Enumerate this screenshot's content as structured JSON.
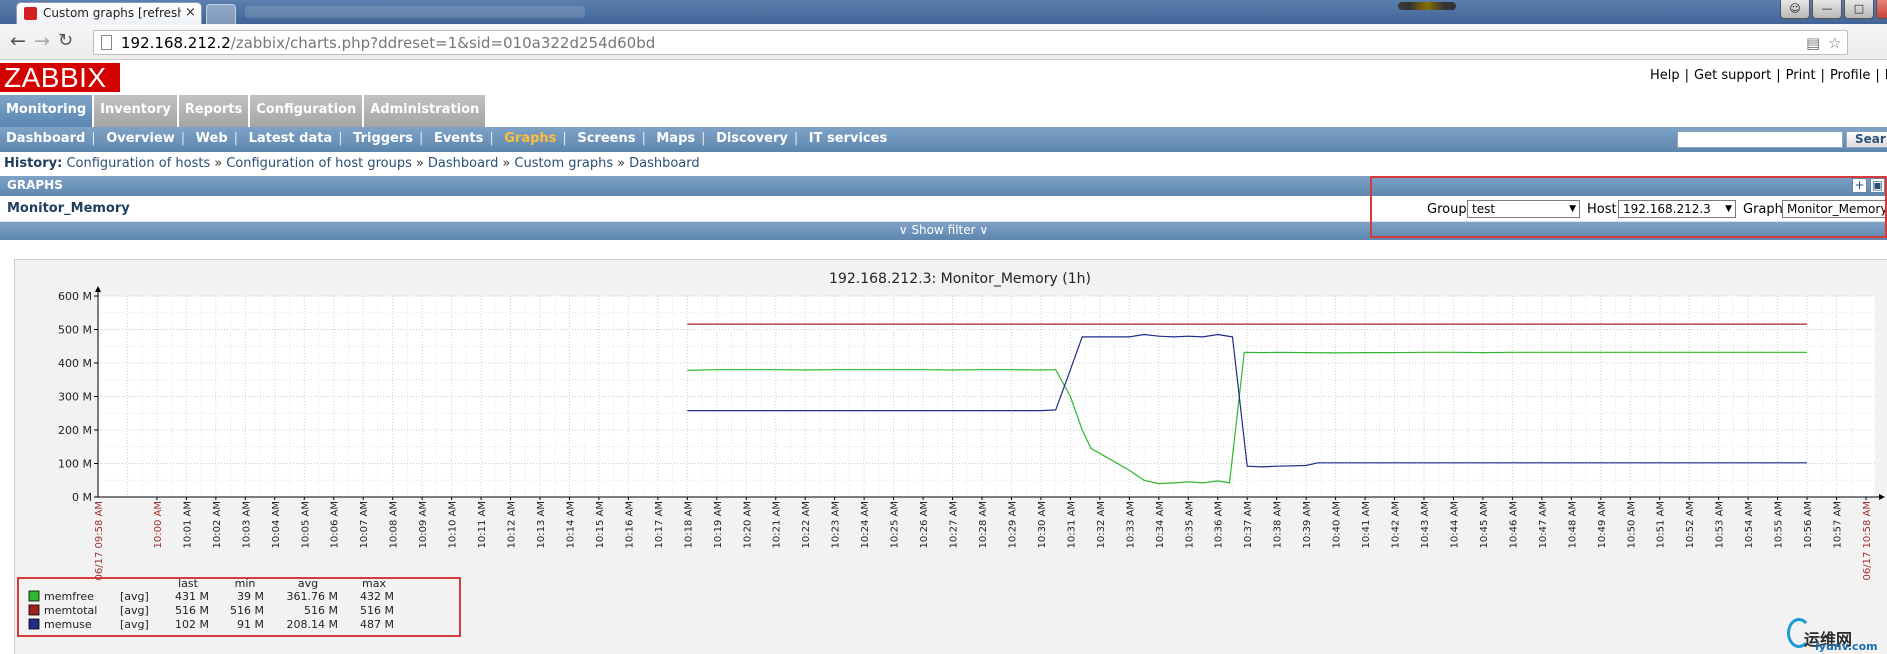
{
  "browser": {
    "tab_title": "Custom graphs [refreshe",
    "tab_close": "×",
    "url_host": "192.168.212.2",
    "url_path": "/zabbix/charts.php?ddreset=1&sid=010a322d254d60bd"
  },
  "header": {
    "logo": "ZABBIX",
    "links": [
      "Help",
      "Get support",
      "Print",
      "Profile",
      "Lo"
    ]
  },
  "main_menu": [
    {
      "label": "Monitoring",
      "active": true
    },
    {
      "label": "Inventory",
      "active": false
    },
    {
      "label": "Reports",
      "active": false
    },
    {
      "label": "Configuration",
      "active": false
    },
    {
      "label": "Administration",
      "active": false
    }
  ],
  "sub_menu": [
    {
      "label": "Dashboard"
    },
    {
      "label": "Overview"
    },
    {
      "label": "Web"
    },
    {
      "label": "Latest data"
    },
    {
      "label": "Triggers"
    },
    {
      "label": "Events"
    },
    {
      "label": "Graphs",
      "active": true
    },
    {
      "label": "Screens"
    },
    {
      "label": "Maps"
    },
    {
      "label": "Discovery"
    },
    {
      "label": "IT services"
    }
  ],
  "search": {
    "button_label": "Sear"
  },
  "history": {
    "label": "History:",
    "items": [
      "Configuration of hosts",
      "Configuration of host groups",
      "Dashboard",
      "Custom graphs",
      "Dashboard"
    ]
  },
  "graphs_section": {
    "title": "GRAPHS",
    "graph_name": "Monitor_Memory",
    "show_filter": "∨ Show filter ∨",
    "filter": {
      "group_label": "Group",
      "group_value": "test",
      "host_label": "Host",
      "host_value": "192.168.212.3",
      "graph_label": "Graph",
      "graph_value": "Monitor_Memory"
    }
  },
  "chart_data": {
    "type": "line",
    "title": "192.168.212.3: Monitor_Memory (1h)",
    "y_unit": "M",
    "ylim": [
      0,
      600
    ],
    "y_ticks": [
      "600 M",
      "500 M",
      "400 M",
      "300 M",
      "200 M",
      "100 M",
      "0 M"
    ],
    "x_start_label": "06/17 09:58 AM",
    "x_end_label": "06/17 10:58 AM",
    "x_ticks": [
      "10:00 AM",
      "10:01 AM",
      "10:02 AM",
      "10:03 AM",
      "10:04 AM",
      "10:05 AM",
      "10:06 AM",
      "10:07 AM",
      "10:08 AM",
      "10:09 AM",
      "10:10 AM",
      "10:11 AM",
      "10:12 AM",
      "10:13 AM",
      "10:14 AM",
      "10:15 AM",
      "10:16 AM",
      "10:17 AM",
      "10:18 AM",
      "10:19 AM",
      "10:20 AM",
      "10:21 AM",
      "10:22 AM",
      "10:23 AM",
      "10:24 AM",
      "10:25 AM",
      "10:26 AM",
      "10:27 AM",
      "10:28 AM",
      "10:29 AM",
      "10:30 AM",
      "10:31 AM",
      "10:32 AM",
      "10:33 AM",
      "10:34 AM",
      "10:35 AM",
      "10:36 AM",
      "10:37 AM",
      "10:38 AM",
      "10:39 AM",
      "10:40 AM",
      "10:41 AM",
      "10:42 AM",
      "10:43 AM",
      "10:44 AM",
      "10:45 AM",
      "10:46 AM",
      "10:47 AM",
      "10:48 AM",
      "10:49 AM",
      "10:50 AM",
      "10:51 AM",
      "10:52 AM",
      "10:53 AM",
      "10:54 AM",
      "10:55 AM",
      "10:56 AM",
      "10:57 AM",
      "10:58 AM"
    ],
    "grid": true,
    "series": [
      {
        "name": "memfree",
        "color": "#2fb82f",
        "fn": "[avg]",
        "last": "431 M",
        "min": "39 M",
        "avg": "361.76 M",
        "max": "432 M",
        "points": [
          [
            20.0,
            378
          ],
          [
            21.0,
            380
          ],
          [
            22.0,
            380
          ],
          [
            23.0,
            380
          ],
          [
            24.0,
            379
          ],
          [
            25.0,
            380
          ],
          [
            26.0,
            380
          ],
          [
            27.0,
            380
          ],
          [
            28.0,
            380
          ],
          [
            29.0,
            379
          ],
          [
            30.0,
            380
          ],
          [
            31.0,
            380
          ],
          [
            32.0,
            379
          ],
          [
            32.5,
            380
          ],
          [
            33.0,
            300
          ],
          [
            33.4,
            200
          ],
          [
            33.7,
            145
          ],
          [
            34.2,
            120
          ],
          [
            35.0,
            80
          ],
          [
            35.5,
            50
          ],
          [
            36.0,
            40
          ],
          [
            36.5,
            42
          ],
          [
            37.0,
            45
          ],
          [
            37.5,
            42
          ],
          [
            38.0,
            48
          ],
          [
            38.4,
            42
          ],
          [
            38.9,
            432
          ],
          [
            39.5,
            431
          ],
          [
            40.0,
            432
          ],
          [
            41.0,
            431
          ],
          [
            42.0,
            430
          ],
          [
            43.0,
            431
          ],
          [
            44.0,
            431
          ],
          [
            45.0,
            432
          ],
          [
            46.0,
            432
          ],
          [
            47.0,
            431
          ],
          [
            48.0,
            432
          ],
          [
            50.0,
            432
          ],
          [
            52.0,
            432
          ],
          [
            54.0,
            432
          ],
          [
            56.0,
            432
          ],
          [
            58.0,
            432
          ]
        ]
      },
      {
        "name": "memtotal",
        "color": "#a02020",
        "fn": "[avg]",
        "last": "516 M",
        "min": "516 M",
        "avg": "516 M",
        "max": "516 M",
        "points": [
          [
            20.0,
            516
          ],
          [
            58.0,
            516
          ]
        ]
      },
      {
        "name": "memuse",
        "color": "#1f2d8a",
        "fn": "[avg]",
        "last": "102 M",
        "min": "91 M",
        "avg": "208.14 M",
        "max": "487 M",
        "points": [
          [
            20.0,
            258
          ],
          [
            25.0,
            258
          ],
          [
            30.0,
            258
          ],
          [
            32.0,
            258
          ],
          [
            32.5,
            260
          ],
          [
            33.0,
            380
          ],
          [
            33.4,
            478
          ],
          [
            34.0,
            478
          ],
          [
            35.0,
            478
          ],
          [
            35.5,
            485
          ],
          [
            36.0,
            480
          ],
          [
            36.5,
            478
          ],
          [
            37.0,
            480
          ],
          [
            37.5,
            478
          ],
          [
            38.0,
            485
          ],
          [
            38.5,
            478
          ],
          [
            39.0,
            92
          ],
          [
            39.5,
            90
          ],
          [
            40.0,
            92
          ],
          [
            41.0,
            94
          ],
          [
            41.4,
            102
          ],
          [
            42.0,
            102
          ],
          [
            45.0,
            102
          ],
          [
            50.0,
            102
          ],
          [
            55.0,
            102
          ],
          [
            58.0,
            102
          ]
        ]
      }
    ],
    "legend_header": [
      "last",
      "min",
      "avg",
      "max"
    ]
  }
}
